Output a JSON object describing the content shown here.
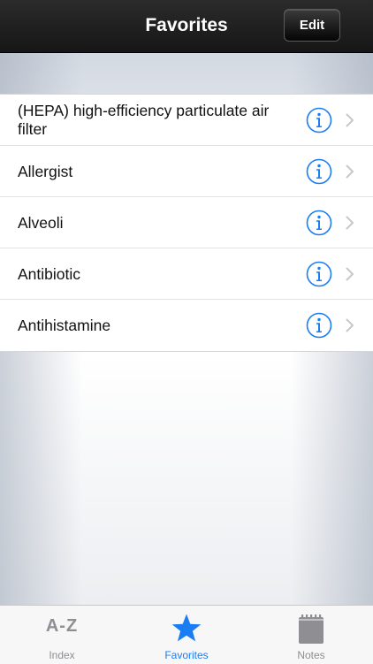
{
  "navbar": {
    "title": "Favorites",
    "edit_label": "Edit"
  },
  "favorites": {
    "items": [
      {
        "label": "(HEPA) high-efficiency particulate air filter"
      },
      {
        "label": "Allergist"
      },
      {
        "label": "Alveoli"
      },
      {
        "label": "Antibiotic"
      },
      {
        "label": "Antihistamine"
      }
    ]
  },
  "tabbar": {
    "index": {
      "glyph": "A-Z",
      "label": "Index",
      "icon": "az-icon"
    },
    "favorites": {
      "label": "Favorites",
      "icon": "star-icon"
    },
    "notes": {
      "label": "Notes",
      "icon": "notepad-icon"
    }
  },
  "colors": {
    "accent": "#1a7ef2",
    "inactive": "#8e8e93",
    "navbar": "#1f1f1f"
  }
}
